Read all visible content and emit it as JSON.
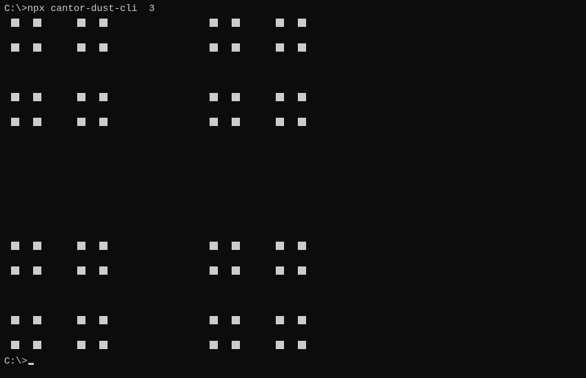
{
  "prompt1": {
    "prefix": "C:\\>",
    "command": "npx cantor-dust-cli  3"
  },
  "prompt2": {
    "prefix": "C:\\>"
  },
  "fractal": {
    "depth": 3,
    "grid_size": 27,
    "base_pattern": [
      [
        1,
        0,
        1
      ],
      [
        0,
        0,
        0
      ],
      [
        1,
        0,
        1
      ]
    ]
  },
  "colors": {
    "bg": "#0c0c0c",
    "fg": "#cccccc"
  }
}
